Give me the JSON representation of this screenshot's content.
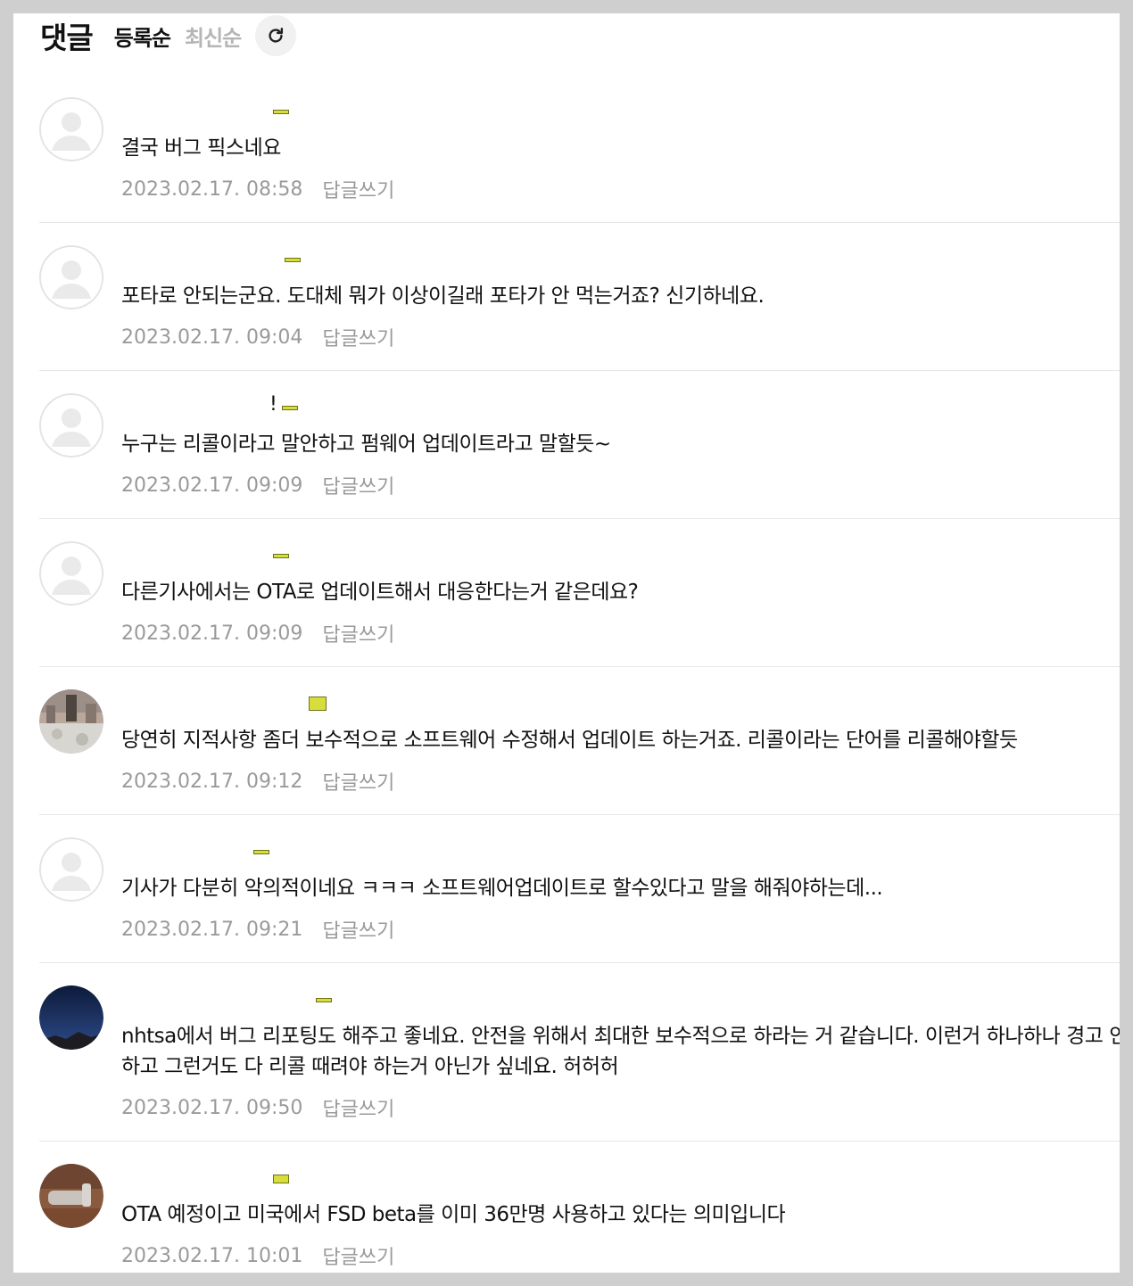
{
  "header": {
    "title": "댓글",
    "sort_registered": "등록순",
    "sort_latest": "최신순",
    "refresh_icon": "refresh-icon"
  },
  "comments": [
    {
      "text": "결국 버그 픽스네요",
      "date": "2023.02.17. 08:58",
      "reply_label": "답글쓰기",
      "avatar": "default"
    },
    {
      "text": "포타로 안되는군요. 도대체 뭐가 이상이길래 포타가 안 먹는거죠? 신기하네요.",
      "date": "2023.02.17. 09:04",
      "reply_label": "답글쓰기",
      "avatar": "default"
    },
    {
      "text": "누구는 리콜이라고 말안하고 펌웨어 업데이트라고 말할듯~",
      "date": "2023.02.17. 09:09",
      "reply_label": "답글쓰기",
      "avatar": "default",
      "nick_mark": "!"
    },
    {
      "text": "다른기사에서는 OTA로 업데이트해서 대응한다는거 같은데요?",
      "date": "2023.02.17. 09:09",
      "reply_label": "답글쓰기",
      "avatar": "default"
    },
    {
      "text": "당연히 지적사항 좀더 보수적으로 소프트웨어 수정해서 업데이트 하는거죠. 리콜이라는 단어를 리콜해야할듯",
      "date": "2023.02.17. 09:12",
      "reply_label": "답글쓰기",
      "avatar": "photo-city"
    },
    {
      "text": "기사가 다분히 악의적이네요 ㅋㅋㅋ 소프트웨어업데이트로 할수있다고 말을 해줘야하는데...",
      "date": "2023.02.17. 09:21",
      "reply_label": "답글쓰기",
      "avatar": "default"
    },
    {
      "text": "nhtsa에서 버그 리포팅도 해주고 좋네요. 안전을 위해서 최대한 보수적으로 하라는 거 같습니다. 이런거 하나하나 경고 안하고 그런거도 다 리콜 때려야 하는거 아닌가 싶네요. 허허허",
      "date": "2023.02.17. 09:50",
      "reply_label": "답글쓰기",
      "avatar": "photo-night"
    },
    {
      "text": "OTA 예정이고 미국에서 FSD beta를 이미 36만명 사용하고 있다는 의미입니다",
      "date": "2023.02.17. 10:01",
      "reply_label": "답글쓰기",
      "avatar": "photo-car"
    }
  ],
  "colors": {
    "accent_mark": "#d7dd3b",
    "meta_gray": "#9a9a9a",
    "inactive_gray": "#b5b5b5"
  }
}
